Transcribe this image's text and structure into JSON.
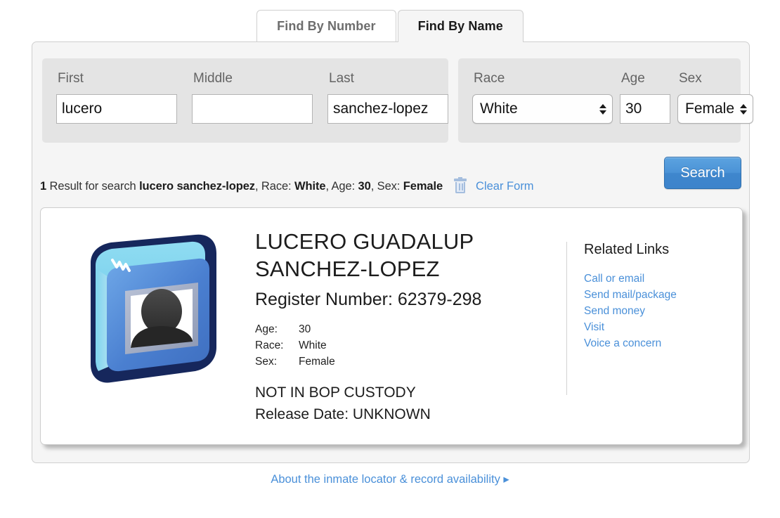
{
  "tabs": [
    {
      "label": "Find By Number",
      "active": false
    },
    {
      "label": "Find By Name",
      "active": true
    }
  ],
  "form": {
    "first": {
      "label": "First",
      "value": "lucero"
    },
    "middle": {
      "label": "Middle",
      "value": ""
    },
    "last": {
      "label": "Last",
      "value": "sanchez-lopez"
    },
    "race": {
      "label": "Race",
      "value": "White"
    },
    "age": {
      "label": "Age",
      "value": "30"
    },
    "sex": {
      "label": "Sex",
      "value": "Female"
    }
  },
  "summary": {
    "count": "1",
    "result_word": " Result for search ",
    "search_terms": "lucero sanchez-lopez",
    "race_key": ", Race: ",
    "race_value": "White",
    "age_key": ", Age: ",
    "age_value": "30",
    "sex_key": ", Sex: ",
    "sex_value": "Female",
    "clear_form": "Clear Form",
    "trash_icon": "trash-icon"
  },
  "search_button": {
    "label": "Search"
  },
  "result": {
    "photo_icon": "photo-placeholder-icon",
    "name": "LUCERO GUADALUP SANCHEZ-LOPEZ",
    "register_number_label": "Register Number: 62379-298",
    "attributes": [
      {
        "key": "Age:",
        "value": "30"
      },
      {
        "key": "Race:",
        "value": "White"
      },
      {
        "key": "Sex:",
        "value": "Female"
      }
    ],
    "custody_status": "NOT IN BOP CUSTODY",
    "release_date": "Release Date: UNKNOWN"
  },
  "related_links": {
    "title": "Related Links",
    "items": [
      "Call or email",
      "Send mail/package",
      "Send money",
      "Visit",
      "Voice a concern"
    ]
  },
  "footer": {
    "link": "About the inmate locator & record availability ▸"
  },
  "colors": {
    "accent_link": "#4a90d9",
    "button_blue": "#4a92d6",
    "panel_gray": "#f5f5f5",
    "fieldgroup_gray": "#e4e4e4"
  }
}
